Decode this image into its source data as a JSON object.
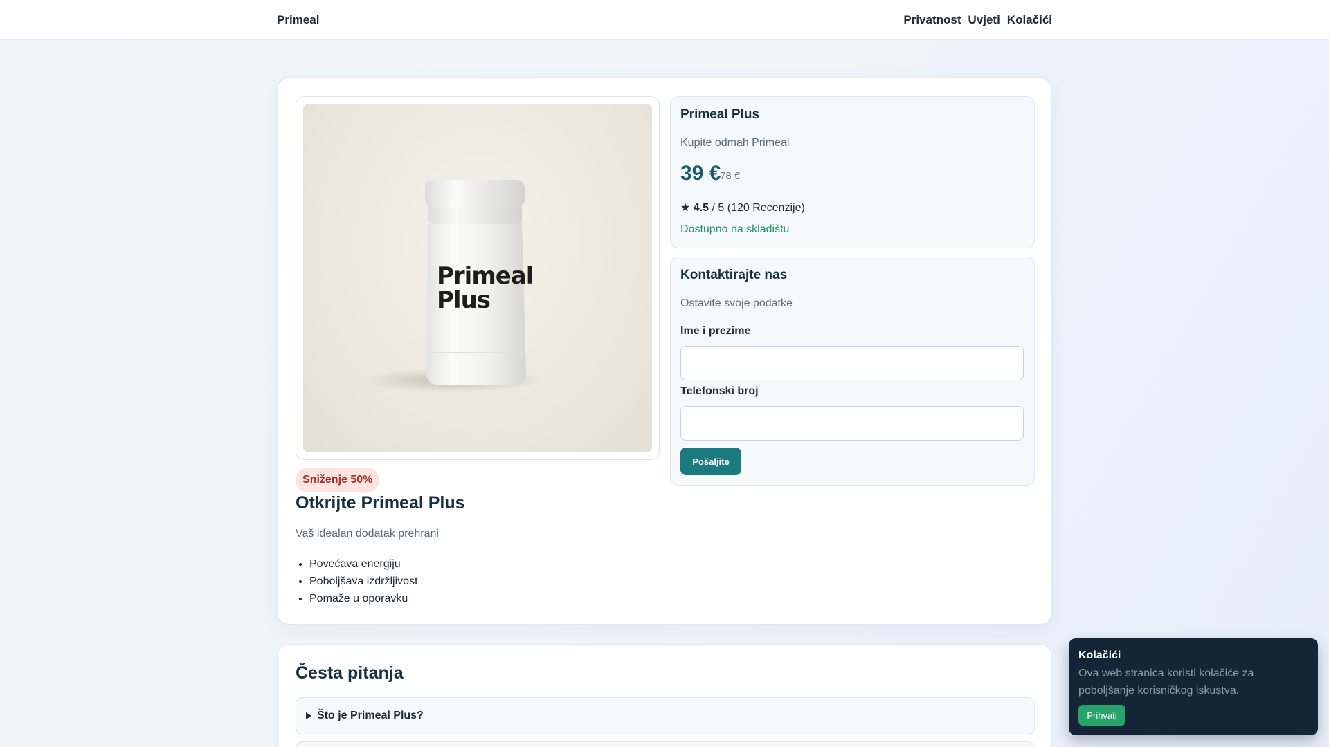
{
  "header": {
    "brand": "Primeal",
    "nav": [
      "Privatnost",
      "Uvjeti",
      "Kolačići"
    ]
  },
  "product_image": {
    "label_line1": "Primeal",
    "label_line2": "Plus"
  },
  "promo": {
    "badge": "Sniženje 50%",
    "title": "Otkrijte Primeal Plus",
    "subtitle": "Vaš idealan dodatak prehrani",
    "benefits": [
      "Povećava energiju",
      "Poboljšava izdržljivost",
      "Pomaže u oporavku"
    ]
  },
  "product": {
    "name": "Primeal Plus",
    "tagline": "Kupite odmah Primeal",
    "price": "39 €",
    "old_price": "78 €",
    "rating_star": "★",
    "rating_value": "4.5",
    "rating_rest": "/ 5 (120 Recenzije)",
    "stock": "Dostupno na skladištu"
  },
  "contact": {
    "title": "Kontaktirajte nas",
    "subtitle": "Ostavite svoje podatke",
    "name_label": "Ime i prezime",
    "name_value": "",
    "phone_label": "Telefonski broj",
    "phone_value": "",
    "submit": "Pošaljite"
  },
  "faq": {
    "title": "Česta pitanja",
    "items": [
      "Što je Primeal Plus?"
    ]
  },
  "cookie": {
    "title": "Kolačići",
    "text": "Ova web stranica koristi kolačiće za poboljšanje korisničkog iskustva.",
    "accept": "Prihvati"
  },
  "colors": {
    "accent": "#1a7a80",
    "price": "#1d5b6b",
    "stock": "#2b9162",
    "badge_bg": "#fde4e0",
    "badge_text": "#a23020",
    "cookie_bg": "#142537",
    "cookie_button": "#27a36a"
  }
}
